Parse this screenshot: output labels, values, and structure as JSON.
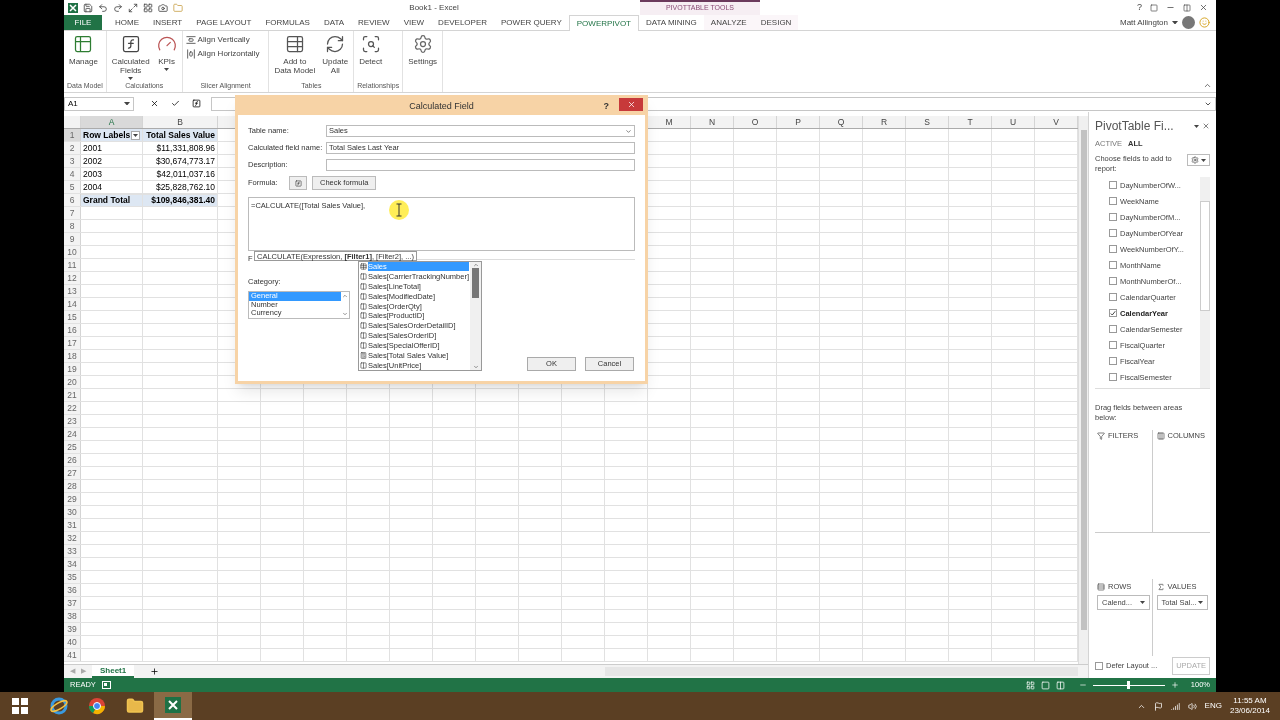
{
  "title_bar": {
    "title": "Book1 - Excel",
    "context_label": "PIVOTTABLE TOOLS",
    "help": "?"
  },
  "ribbon_tabs": [
    {
      "label": "FILE",
      "kind": "file",
      "selected": false
    },
    {
      "label": "HOME",
      "kind": "normal",
      "selected": false
    },
    {
      "label": "INSERT",
      "kind": "normal",
      "selected": false
    },
    {
      "label": "PAGE LAYOUT",
      "kind": "normal",
      "selected": false
    },
    {
      "label": "FORMULAS",
      "kind": "normal",
      "selected": false
    },
    {
      "label": "DATA",
      "kind": "normal",
      "selected": false
    },
    {
      "label": "REVIEW",
      "kind": "normal",
      "selected": false
    },
    {
      "label": "VIEW",
      "kind": "normal",
      "selected": false
    },
    {
      "label": "DEVELOPER",
      "kind": "normal",
      "selected": false
    },
    {
      "label": "POWER QUERY",
      "kind": "normal",
      "selected": false
    },
    {
      "label": "POWERPIVOT",
      "kind": "normal",
      "selected": true
    },
    {
      "label": "DATA MINING",
      "kind": "normal",
      "selected": false
    },
    {
      "label": "ANALYZE",
      "kind": "context",
      "selected": false
    },
    {
      "label": "DESIGN",
      "kind": "context",
      "selected": false
    }
  ],
  "user": {
    "name": "Matt Allington"
  },
  "ribbon_groups": [
    {
      "label": "Data Model",
      "buttons": [
        {
          "lines": [
            "Manage"
          ],
          "kind": "manage",
          "dropdown": false
        }
      ]
    },
    {
      "label": "Calculations",
      "buttons": [
        {
          "lines": [
            "Calculated",
            "Fields"
          ],
          "kind": "fx",
          "dropdown": true
        },
        {
          "lines": [
            "KPIs"
          ],
          "kind": "kpi",
          "dropdown": true
        }
      ]
    },
    {
      "label": "Slicer Alignment",
      "small_buttons": [
        {
          "label": "Align Vertically",
          "kind": "vertical"
        },
        {
          "label": "Align Horizontally",
          "kind": "horizontal"
        }
      ]
    },
    {
      "label": "Tables",
      "buttons": [
        {
          "lines": [
            "Add to",
            "Data Model"
          ],
          "kind": "add",
          "dropdown": false
        },
        {
          "lines": [
            "Update",
            "All"
          ],
          "kind": "refresh",
          "dropdown": false
        }
      ]
    },
    {
      "label": "Relationships",
      "buttons": [
        {
          "lines": [
            "Detect"
          ],
          "kind": "detect",
          "dropdown": false
        }
      ]
    },
    {
      "buttons": [
        {
          "lines": [
            "Settings"
          ],
          "kind": "gear",
          "dropdown": false
        }
      ]
    }
  ],
  "formula_bar": {
    "name_box": "A1"
  },
  "column_headers": [
    "A",
    "B",
    "M",
    "N",
    "O",
    "P",
    "Q",
    "R",
    "S",
    "T",
    "U",
    "V"
  ],
  "rows": [
    {
      "number": "1",
      "kind": "header",
      "cells": [
        "Row Labels",
        "Total Sales Value"
      ]
    },
    {
      "number": "2",
      "kind": "data",
      "cells": [
        "2001",
        "$11,331,808.96"
      ]
    },
    {
      "number": "3",
      "kind": "data",
      "cells": [
        "2002",
        "$30,674,773.17"
      ]
    },
    {
      "number": "4",
      "kind": "data",
      "cells": [
        "2003",
        "$42,011,037.16"
      ]
    },
    {
      "number": "5",
      "kind": "data",
      "cells": [
        "2004",
        "$25,828,762.10"
      ]
    },
    {
      "number": "6",
      "kind": "total",
      "cells": [
        "Grand Total",
        "$109,846,381.40"
      ]
    },
    {
      "number": "7",
      "kind": "empty"
    },
    {
      "number": "8",
      "kind": "empty"
    },
    {
      "number": "9",
      "kind": "empty"
    },
    {
      "number": "10",
      "kind": "empty"
    },
    {
      "number": "11",
      "kind": "empty"
    },
    {
      "number": "12",
      "kind": "empty"
    },
    {
      "number": "13",
      "kind": "empty"
    },
    {
      "number": "14",
      "kind": "empty"
    },
    {
      "number": "15",
      "kind": "empty"
    },
    {
      "number": "16",
      "kind": "empty"
    },
    {
      "number": "17",
      "kind": "empty"
    },
    {
      "number": "18",
      "kind": "empty"
    },
    {
      "number": "19",
      "kind": "empty"
    },
    {
      "number": "20",
      "kind": "empty"
    },
    {
      "number": "21",
      "kind": "empty"
    },
    {
      "number": "22",
      "kind": "empty"
    },
    {
      "number": "23",
      "kind": "empty"
    },
    {
      "number": "24",
      "kind": "empty"
    },
    {
      "number": "25",
      "kind": "empty"
    },
    {
      "number": "26",
      "kind": "empty"
    },
    {
      "number": "27",
      "kind": "empty"
    },
    {
      "number": "28",
      "kind": "empty"
    },
    {
      "number": "29",
      "kind": "empty"
    },
    {
      "number": "30",
      "kind": "empty"
    },
    {
      "number": "31",
      "kind": "empty"
    },
    {
      "number": "32",
      "kind": "empty"
    },
    {
      "number": "33",
      "kind": "empty"
    },
    {
      "number": "34",
      "kind": "empty"
    },
    {
      "number": "35",
      "kind": "empty"
    },
    {
      "number": "36",
      "kind": "empty"
    },
    {
      "number": "37",
      "kind": "empty"
    },
    {
      "number": "38",
      "kind": "empty"
    },
    {
      "number": "39",
      "kind": "empty"
    },
    {
      "number": "40",
      "kind": "empty"
    },
    {
      "number": "41",
      "kind": "empty"
    }
  ],
  "sheet_nav": [
    "◀",
    "▶"
  ],
  "sheet_tabs": [
    {
      "label": "Sheet1",
      "selected": true
    }
  ],
  "status_bar": {
    "mode": "READY",
    "zoom": "100%",
    "zoom_slider": {
      "level": 0.5
    }
  },
  "dialog": {
    "title": "Calculated Field",
    "help": "?",
    "table_name": {
      "label": "Table name:",
      "value": "Sales"
    },
    "field_name": {
      "label": "Calculated field name:",
      "value": "Total Sales Last Year"
    },
    "description": {
      "label": "Description:"
    },
    "formula_label": "Formula:",
    "check_formula": "Check formula",
    "formula": "=CALCULATE([Total Sales Value],",
    "tooltip": "CALCULATE(Expression, **[Filter1]**, [Filter2], ...)",
    "partial_label": "F",
    "category": {
      "label": "Category:",
      "options": [
        {
          "label": "General",
          "selected": true
        },
        {
          "label": "Number",
          "selected": false
        },
        {
          "label": "Currency",
          "selected": false
        }
      ]
    },
    "autocomplete": [
      {
        "kind": "table",
        "label": "Sales",
        "selected": true
      },
      {
        "kind": "column",
        "label": "Sales[CarrierTrackingNumber]",
        "selected": false
      },
      {
        "kind": "column",
        "label": "Sales[LineTotal]",
        "selected": false
      },
      {
        "kind": "column",
        "label": "Sales[ModifiedDate]",
        "selected": false
      },
      {
        "kind": "column",
        "label": "Sales[OrderQty]",
        "selected": false
      },
      {
        "kind": "column",
        "label": "Sales[ProductID]",
        "selected": false
      },
      {
        "kind": "column",
        "label": "Sales[SalesOrderDetailID]",
        "selected": false
      },
      {
        "kind": "column",
        "label": "Sales[SalesOrderID]",
        "selected": false
      },
      {
        "kind": "column",
        "label": "Sales[SpecialOfferID]",
        "selected": false
      },
      {
        "kind": "measure",
        "label": "Sales[Total Sales Value]",
        "selected": false
      },
      {
        "kind": "column",
        "label": "Sales[UnitPrice]",
        "selected": false
      }
    ],
    "ok": "OK",
    "cancel": "Cancel"
  },
  "pivot": {
    "title": "PivotTable Fi...",
    "tabs": [
      {
        "label": "ACTIVE",
        "selected": false
      },
      {
        "label": "ALL",
        "selected": true
      }
    ],
    "prompt": "Choose fields to add to report:",
    "fields": [
      {
        "name": "DayNumberOfW...",
        "checked": false
      },
      {
        "name": "WeekName",
        "checked": false
      },
      {
        "name": "DayNumberOfM...",
        "checked": false
      },
      {
        "name": "DayNumberOfYear",
        "checked": false
      },
      {
        "name": "WeekNumberOfY...",
        "checked": false
      },
      {
        "name": "MonthName",
        "checked": false
      },
      {
        "name": "MonthNumberOf...",
        "checked": false
      },
      {
        "name": "CalendarQuarter",
        "checked": false
      },
      {
        "name": "CalendarYear",
        "checked": true
      },
      {
        "name": "CalendarSemester",
        "checked": false
      },
      {
        "name": "FiscalQuarter",
        "checked": false
      },
      {
        "name": "FiscalYear",
        "checked": false
      },
      {
        "name": "FiscalSemester",
        "checked": false
      }
    ],
    "drag_prompt": "Drag fields between areas below:",
    "areas": [
      {
        "kind": "filters",
        "label": "FILTERS"
      },
      {
        "kind": "columns",
        "label": "COLUMNS"
      },
      {
        "kind": "rows",
        "label": "ROWS",
        "chips": [
          "Calend..."
        ]
      },
      {
        "kind": "values",
        "label": "VALUES",
        "chips": [
          "Total Sal..."
        ]
      }
    ],
    "defer": {
      "label": "Defer Layout ...",
      "checked": false
    },
    "update": {
      "label": "UPDATE",
      "disabled": true
    }
  },
  "taskbar": {
    "apps": [
      {
        "kind": "ie",
        "selected": false
      },
      {
        "kind": "chrome",
        "selected": false
      },
      {
        "kind": "explorer",
        "selected": false
      },
      {
        "kind": "excel",
        "selected": true
      }
    ],
    "language": "ENG",
    "time": "11:55 AM",
    "date": "23/06/2014"
  }
}
